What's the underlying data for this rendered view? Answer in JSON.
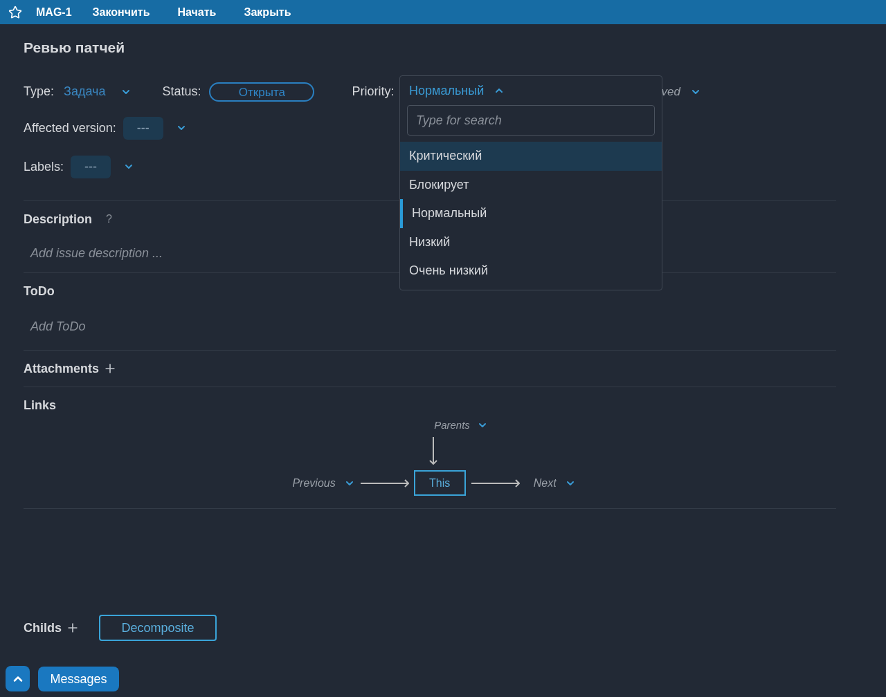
{
  "top_bar": {
    "issue_key": "MAG-1",
    "actions": [
      "Закончить",
      "Начать",
      "Закрыть"
    ]
  },
  "title": "Ревью патчей",
  "fields": {
    "type": {
      "label": "Type:",
      "value": "Задача"
    },
    "status": {
      "label": "Status:",
      "value": "Открыта"
    },
    "priority": {
      "label": "Priority:",
      "value": "Нормальный",
      "expanded": true
    },
    "hidden_field": {
      "value": "ved"
    },
    "affected_version": {
      "label": "Affected version:",
      "value": "---"
    },
    "labels": {
      "label": "Labels:",
      "value": "---"
    }
  },
  "priority_dropdown": {
    "search_placeholder": "Type for search",
    "options": [
      {
        "label": "Критический",
        "highlighted": true,
        "selected": false
      },
      {
        "label": "Блокирует",
        "highlighted": false,
        "selected": false
      },
      {
        "label": "Нормальный",
        "highlighted": false,
        "selected": true
      },
      {
        "label": "Низкий",
        "highlighted": false,
        "selected": false
      },
      {
        "label": "Очень низкий",
        "highlighted": false,
        "selected": false
      }
    ]
  },
  "description": {
    "title": "Description",
    "help": "?",
    "placeholder": "Add issue description ..."
  },
  "todo": {
    "title": "ToDo",
    "placeholder": "Add ToDo"
  },
  "attachments": {
    "title": "Attachments"
  },
  "links": {
    "title": "Links",
    "parents": "Parents",
    "previous": "Previous",
    "this": "This",
    "next": "Next"
  },
  "childs": {
    "title": "Childs",
    "button": "Decomposite"
  },
  "messages_button": "Messages"
}
